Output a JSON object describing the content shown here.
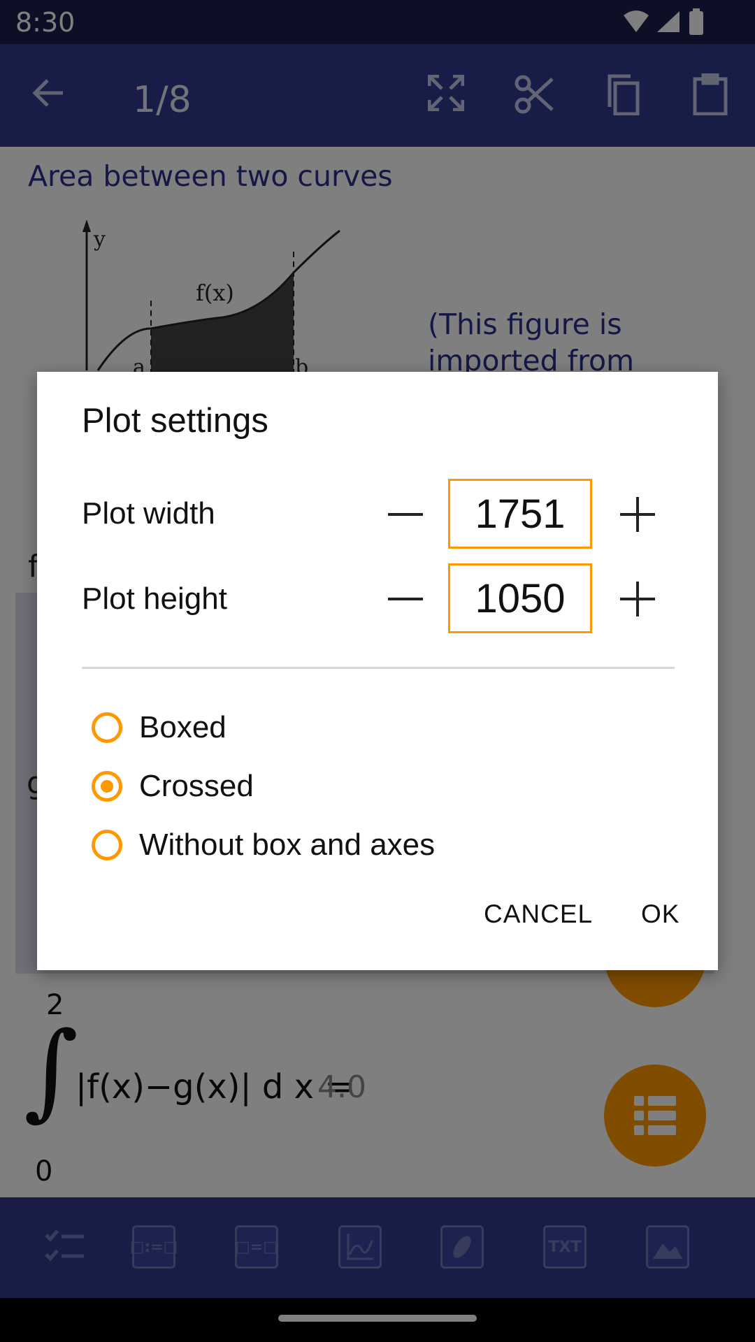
{
  "status_bar": {
    "time": "8:30"
  },
  "app_bar": {
    "page_counter": "1/8",
    "icons": [
      "back-arrow-icon",
      "fullscreen-icon",
      "cut-icon",
      "copy-icon",
      "paste-icon"
    ]
  },
  "document": {
    "title": "Area between two curves",
    "figure_labels": {
      "y": "y",
      "fx": "f(x)",
      "a": "a",
      "b": "b"
    },
    "figure_note": "(This figure is imported from",
    "partial_f": "f",
    "partial_g": "g",
    "integral": {
      "upper": "2",
      "lower": "0",
      "expression": "|f(x)−g(x)| d x =",
      "result": "4.0"
    }
  },
  "dialog": {
    "title": "Plot settings",
    "width_label": "Plot width",
    "width_value": "1751",
    "height_label": "Plot height",
    "height_value": "1050",
    "options": [
      {
        "label": "Boxed",
        "selected": false
      },
      {
        "label": "Crossed",
        "selected": true
      },
      {
        "label": "Without box and axes",
        "selected": false
      }
    ],
    "cancel_label": "CANCEL",
    "ok_label": "OK"
  },
  "bottom_toolbar": {
    "items": [
      "",
      "□:=□",
      "□=□",
      "",
      "",
      "TXT",
      ""
    ]
  },
  "colors": {
    "accent": "#ff9800",
    "primary": "#2f3a8f",
    "status": "#1a1e4f"
  }
}
